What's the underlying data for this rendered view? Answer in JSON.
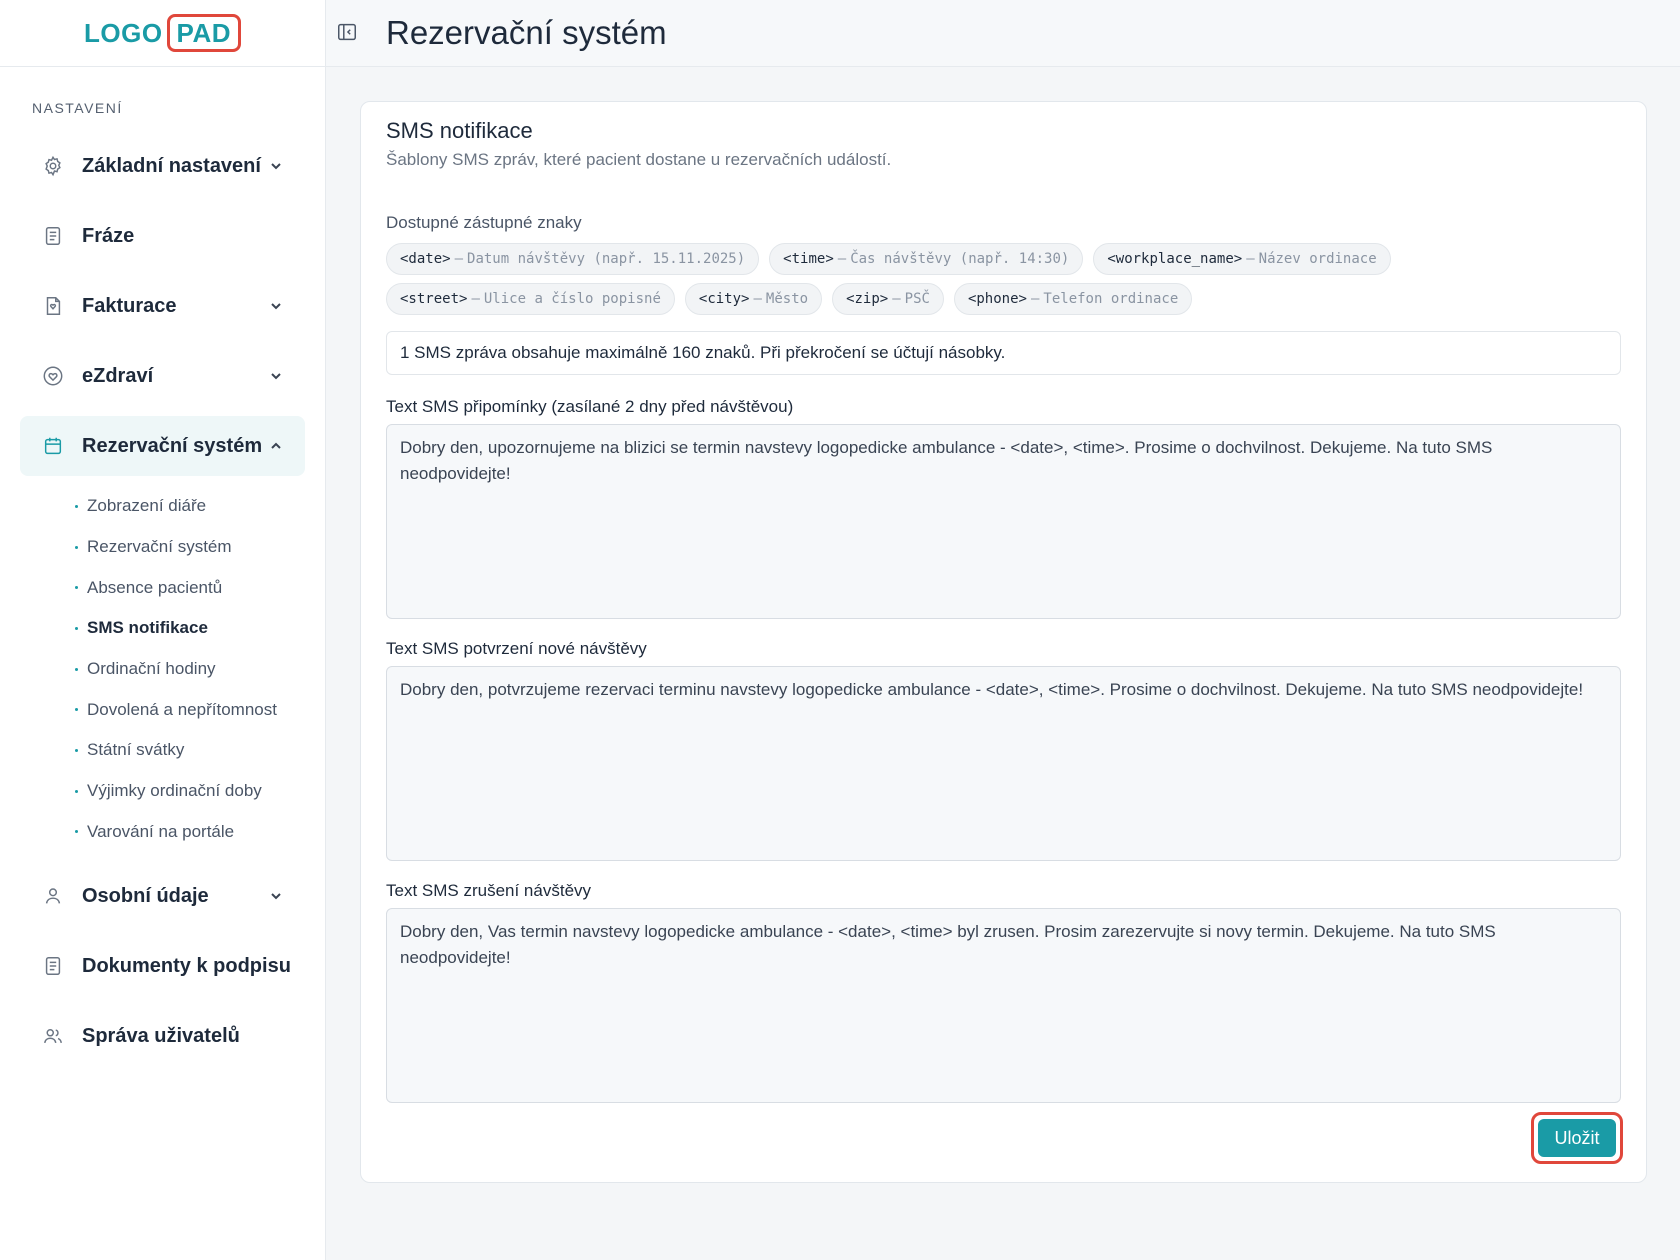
{
  "logo": {
    "part1": "LOGO",
    "part2": "PAD"
  },
  "header": {
    "title": "Rezervační systém"
  },
  "sidebar": {
    "section_label": "NASTAVENÍ",
    "items": [
      {
        "label": "Základní nastavení",
        "icon": "gear-icon",
        "expandable": true
      },
      {
        "label": "Fráze",
        "icon": "document-icon",
        "expandable": false
      },
      {
        "label": "Fakturace",
        "icon": "invoice-icon",
        "expandable": true
      },
      {
        "label": "eZdraví",
        "icon": "heart-icon",
        "expandable": true
      },
      {
        "label": "Rezervační systém",
        "icon": "calendar-icon",
        "expandable": true,
        "active": true
      },
      {
        "label": "Osobní údaje",
        "icon": "user-icon",
        "expandable": true
      },
      {
        "label": "Dokumenty k podpisu",
        "icon": "document-icon",
        "expandable": false
      },
      {
        "label": "Správa uživatelů",
        "icon": "users-icon",
        "expandable": false
      }
    ],
    "subitems": [
      {
        "label": "Zobrazení diáře"
      },
      {
        "label": "Rezervační systém"
      },
      {
        "label": "Absence pacientů"
      },
      {
        "label": "SMS notifikace",
        "current": true
      },
      {
        "label": "Ordinační hodiny"
      },
      {
        "label": "Dovolená a nepřítomnost"
      },
      {
        "label": "Státní svátky"
      },
      {
        "label": "Výjimky ordinační doby"
      },
      {
        "label": "Varování na portále"
      }
    ]
  },
  "card": {
    "title": "SMS notifikace",
    "subtitle": "Šablony SMS zpráv, které pacient dostane u rezervačních událostí.",
    "placeholders_label": "Dostupné zástupné znaky",
    "chips_row1": [
      {
        "tag": "<date>",
        "desc": "Datum návštěvy (např. 15.11.2025)"
      },
      {
        "tag": "<time>",
        "desc": "Čas návštěvy (např. 14:30)"
      },
      {
        "tag": "<workplace_name>",
        "desc": "Název ordinace"
      }
    ],
    "chips_row2": [
      {
        "tag": "<street>",
        "desc": "Ulice a číslo popisné"
      },
      {
        "tag": "<city>",
        "desc": "Město"
      },
      {
        "tag": "<zip>",
        "desc": "PSČ"
      },
      {
        "tag": "<phone>",
        "desc": "Telefon ordinace"
      }
    ],
    "chip_dash": "–",
    "info": "1 SMS zpráva obsahuje maximálně 160 znaků. Při překročení se účtují násobky.",
    "fields": [
      {
        "label": "Text SMS připomínky (zasílané 2 dny před návštěvou)",
        "value": "Dobry den, upozornujeme na blizici se termin navstevy logopedicke ambulance - <date>, <time>. Prosime o dochvilnost. Dekujeme. Na tuto SMS neodpovidejte!"
      },
      {
        "label": "Text SMS potvrzení nové návštěvy",
        "value": "Dobry den, potvrzujeme rezervaci terminu navstevy logopedicke ambulance - <date>, <time>. Prosime o dochvilnost. Dekujeme. Na tuto SMS neodpovidejte!"
      },
      {
        "label": "Text SMS zrušení návštěvy",
        "value": "Dobry den, Vas termin navstevy logopedicke ambulance - <date>, <time> byl zrusen. Prosim zarezervujte si novy termin. Dekujeme. Na tuto SMS neodpovidejte!"
      }
    ],
    "save_label": "Uložit"
  },
  "colors": {
    "accent": "#1a9ba6",
    "highlight": "#e0473b"
  }
}
